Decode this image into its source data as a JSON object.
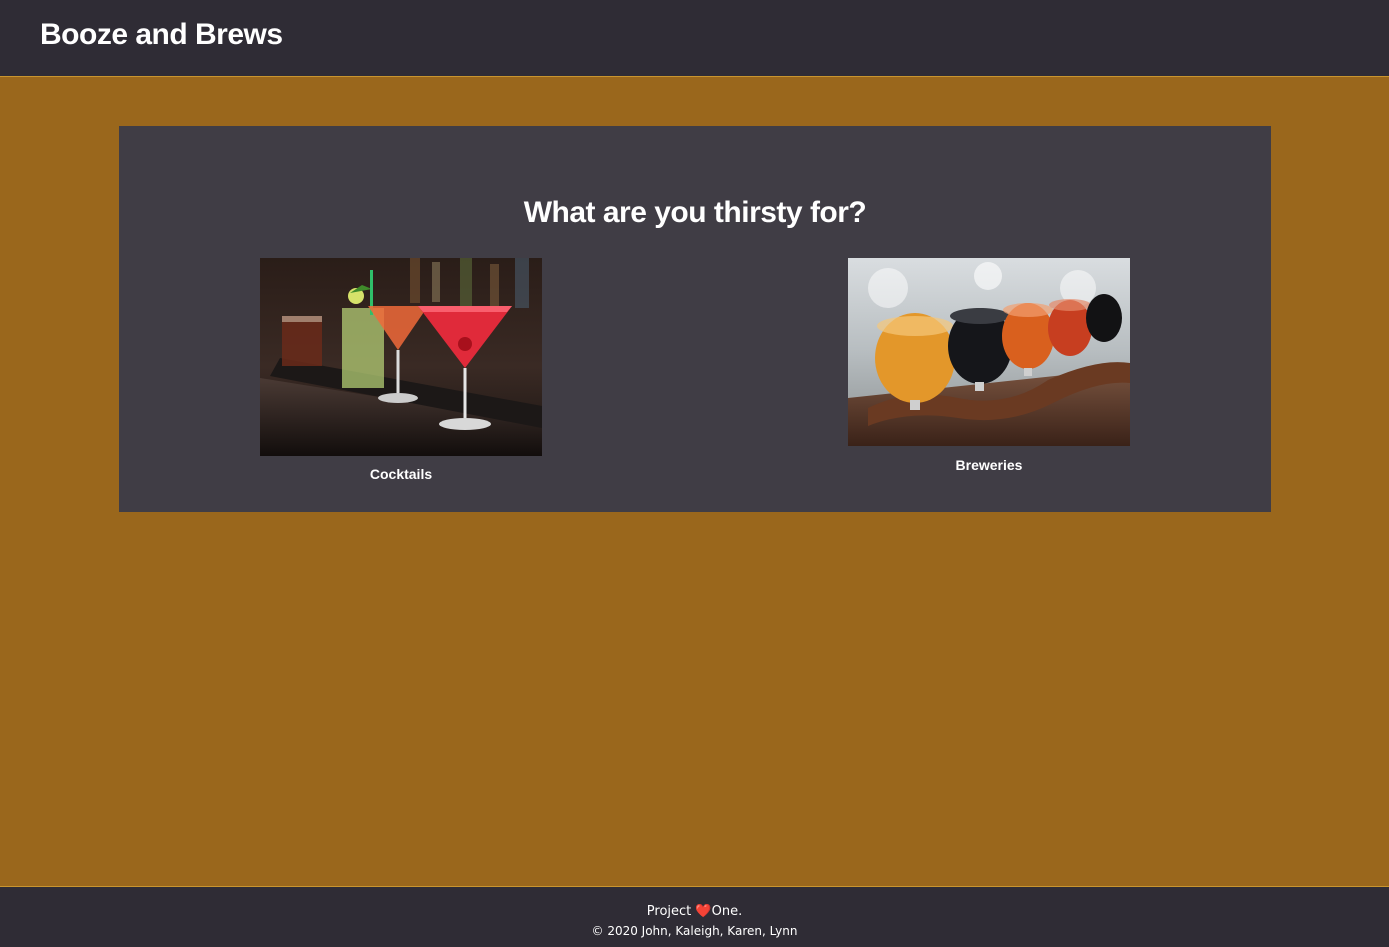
{
  "header": {
    "brand": "Booze and Brews"
  },
  "main": {
    "headline": "What are you thirsty for?",
    "cards": [
      {
        "label": "Cocktails"
      },
      {
        "label": "Breweries"
      }
    ]
  },
  "footer": {
    "project_prefix": "Project ",
    "heart": "❤️",
    "project_suffix": "One.",
    "copyright": "© 2020 John, Kaleigh, Karen, Lynn"
  },
  "colors": {
    "page_bg": "#9a671c",
    "bar_bg": "#2f2c35",
    "panel_bg": "#403d45",
    "accent_border": "#c9952f"
  }
}
